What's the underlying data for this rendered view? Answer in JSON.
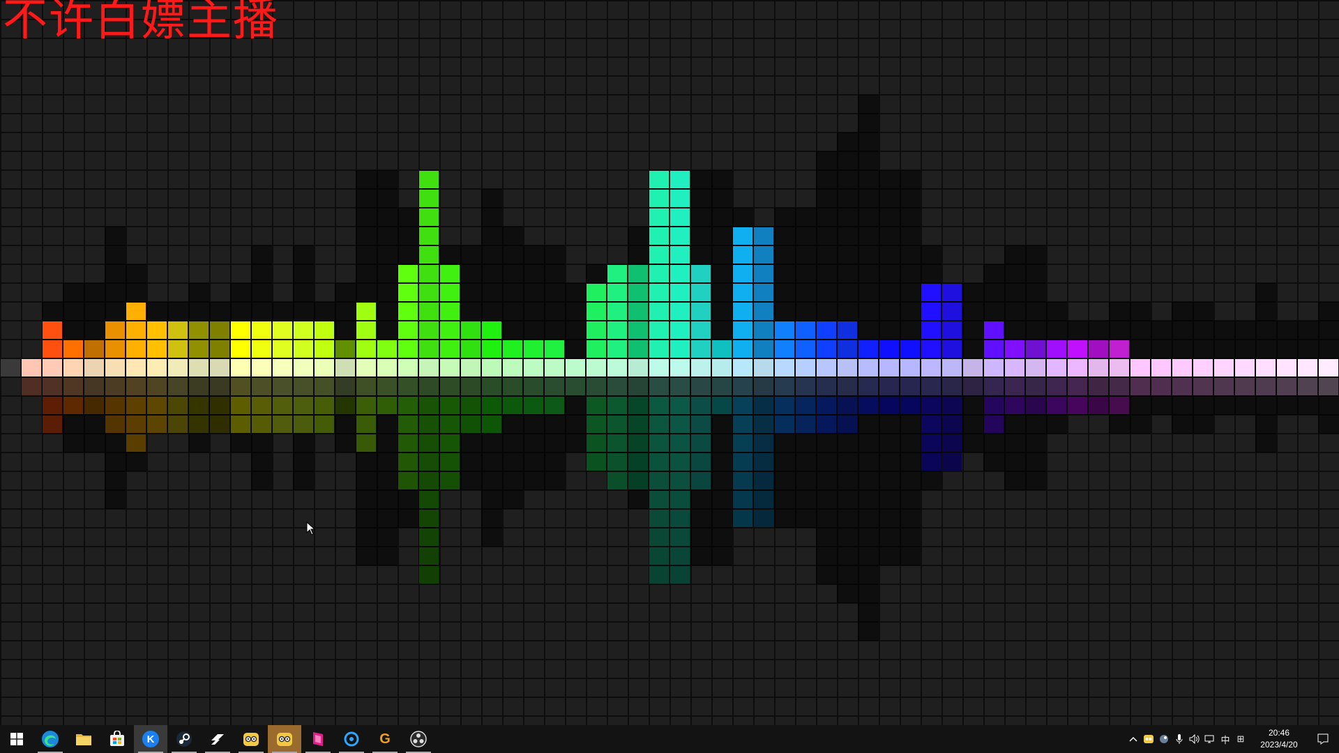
{
  "overlay": {
    "title": "不许白嫖主播"
  },
  "visualizer": {
    "colors_left_to_right": [
      "#ff5010",
      "#ffc010",
      "#ffff20",
      "#8cff10",
      "#30ff30",
      "#20f0a0",
      "#20f0e0",
      "#10c0ff",
      "#1060ff",
      "#1010ff",
      "#8010ff",
      "#c020ff",
      "#ff40ff"
    ],
    "bars": [
      {
        "up": 0,
        "color": "#ff4000"
      },
      {
        "up": 2,
        "color": "#ff5010"
      },
      {
        "up": 1,
        "color": "#ff7000"
      },
      {
        "up": 1,
        "color": "#c07000"
      },
      {
        "up": 2,
        "color": "#e89000"
      },
      {
        "up": 3,
        "color": "#ffb000"
      },
      {
        "up": 2,
        "color": "#ffc000"
      },
      {
        "up": 2,
        "color": "#d0c010"
      },
      {
        "up": 2,
        "color": "#909000"
      },
      {
        "up": 2,
        "color": "#808000"
      },
      {
        "up": 2,
        "color": "#ffff00"
      },
      {
        "up": 2,
        "color": "#f0ff10"
      },
      {
        "up": 2,
        "color": "#e0ff20"
      },
      {
        "up": 2,
        "color": "#d0ff20"
      },
      {
        "up": 2,
        "color": "#c0ff10"
      },
      {
        "up": 1,
        "color": "#609000"
      },
      {
        "up": 3,
        "color": "#a0ff10"
      },
      {
        "up": 1,
        "color": "#80ff10"
      },
      {
        "up": 5,
        "color": "#60ff10"
      },
      {
        "up": 10,
        "color": "#40e010"
      },
      {
        "up": 5,
        "color": "#40f010"
      },
      {
        "up": 2,
        "color": "#30e010"
      },
      {
        "up": 2,
        "color": "#20f010"
      },
      {
        "up": 1,
        "color": "#20f020"
      },
      {
        "up": 1,
        "color": "#20f030"
      },
      {
        "up": 1,
        "color": "#20f040"
      },
      {
        "up": 0,
        "color": "#20f050"
      },
      {
        "up": 4,
        "color": "#20f060"
      },
      {
        "up": 5,
        "color": "#20f080"
      },
      {
        "up": 5,
        "color": "#10c070"
      },
      {
        "up": 10,
        "color": "#20f0b0"
      },
      {
        "up": 10,
        "color": "#20f0c0"
      },
      {
        "up": 5,
        "color": "#20d0c0"
      },
      {
        "up": 1,
        "color": "#10c0c0"
      },
      {
        "up": 7,
        "color": "#10b0f0"
      },
      {
        "up": 7,
        "color": "#1080c0"
      },
      {
        "up": 2,
        "color": "#1080ff"
      },
      {
        "up": 2,
        "color": "#1060ff"
      },
      {
        "up": 2,
        "color": "#1040ff"
      },
      {
        "up": 2,
        "color": "#1030e0"
      },
      {
        "up": 1,
        "color": "#1020ff"
      },
      {
        "up": 1,
        "color": "#1010ff"
      },
      {
        "up": 1,
        "color": "#1010ff"
      },
      {
        "up": 4,
        "color": "#2010ff"
      },
      {
        "up": 4,
        "color": "#2010e0"
      },
      {
        "up": 0,
        "color": "#4000b0"
      },
      {
        "up": 2,
        "color": "#6010ff"
      },
      {
        "up": 1,
        "color": "#8010ff"
      },
      {
        "up": 1,
        "color": "#7010d0"
      },
      {
        "up": 1,
        "color": "#a010ff"
      },
      {
        "up": 1,
        "color": "#c010ff"
      },
      {
        "up": 1,
        "color": "#a010c0"
      },
      {
        "up": 1,
        "color": "#c020d0"
      },
      {
        "up": 0,
        "color": "#ff40ff"
      },
      {
        "up": 0,
        "color": "#ff40ff"
      },
      {
        "up": 0,
        "color": "#ff50ff"
      },
      {
        "up": 0,
        "color": "#ff60ff"
      },
      {
        "up": 0,
        "color": "#ff70ff"
      },
      {
        "up": 0,
        "color": "#ff80ff"
      },
      {
        "up": 0,
        "color": "#ff90ff"
      },
      {
        "up": 0,
        "color": "#ffa0ff"
      },
      {
        "up": 0,
        "color": "#ffb0ff"
      },
      {
        "up": 0,
        "color": "#ffc0ff"
      }
    ],
    "shadow_heights": [
      0,
      3,
      4,
      4,
      7,
      5,
      3,
      3,
      4,
      3,
      4,
      6,
      3,
      6,
      3,
      4,
      10,
      10,
      8,
      10,
      6,
      6,
      9,
      7,
      6,
      6,
      4,
      5,
      5,
      7,
      7,
      6,
      10,
      10,
      8,
      7,
      8,
      8,
      11,
      12,
      14,
      10,
      10,
      6,
      4,
      4,
      5,
      6,
      6,
      3,
      2,
      2,
      3,
      3,
      2,
      3,
      3,
      2,
      2,
      4,
      2,
      2,
      3
    ]
  },
  "taskbar": {
    "pinned": [
      {
        "name": "start-button",
        "icon": "windows-logo"
      },
      {
        "name": "edge-button",
        "icon": "edge-icon"
      },
      {
        "name": "file-explorer-button",
        "icon": "folder-icon"
      },
      {
        "name": "store-button",
        "icon": "store-icon"
      },
      {
        "name": "kugou-button",
        "icon": "k-icon",
        "glyph": "K"
      },
      {
        "name": "steam-button",
        "icon": "steam-icon"
      },
      {
        "name": "app-arrow-button",
        "icon": "arrow-icon"
      },
      {
        "name": "cat-app-button",
        "icon": "cat-icon"
      },
      {
        "name": "cat-app-active-button",
        "icon": "cat-icon"
      },
      {
        "name": "pink-app-button",
        "icon": "pink-icon"
      },
      {
        "name": "blue-circle-app-button",
        "icon": "circle-icon"
      },
      {
        "name": "g-app-button",
        "icon": "g-icon",
        "glyph": "G"
      },
      {
        "name": "obs-button",
        "icon": "obs-icon"
      }
    ],
    "tray": {
      "input_method": "中",
      "grid_glyph": "⊞",
      "time": "20:46",
      "date": "2023/4/20"
    }
  }
}
